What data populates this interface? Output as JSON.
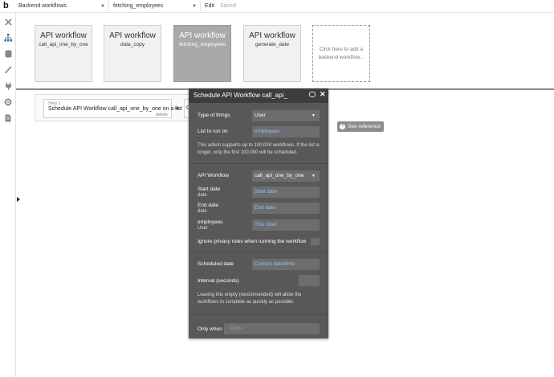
{
  "topbar": {
    "logo": "b",
    "page_select": "Backend workflows",
    "workflow_select": "fetching_employees",
    "edit_label": "Edit",
    "saved_label": "Saved"
  },
  "sidebar": {
    "icons": [
      "tools-icon",
      "hierarchy-icon",
      "database-icon",
      "brush-icon",
      "plug-icon",
      "gear-icon",
      "document-icon"
    ]
  },
  "workflows": [
    {
      "title": "API workflow",
      "name": "call_api_one_by_one"
    },
    {
      "title": "API workflow",
      "name": "data_copy"
    },
    {
      "title": "API workflow",
      "name": "fetching_employees"
    },
    {
      "title": "API workflow",
      "name": "generate_date"
    }
  ],
  "add_workflow": {
    "line1": "Click here to add a",
    "line2": "backend workflow..."
  },
  "step": {
    "number": "Step 1",
    "title": "Schedule API Workflow call_api_one_by_one on a list",
    "delete": "delete",
    "next_initial": "C"
  },
  "see_reference": "See reference",
  "panel": {
    "title": "Schedule API Workflow call_api_",
    "type_of_things": {
      "label": "Type of things",
      "value": "User"
    },
    "list_to_run_on": {
      "label": "List to run on",
      "value": "employees"
    },
    "note1": "This action supports up to 100,000 workflows. If the list is longer, only the first 100,000 will be scheduled.",
    "api_workflow": {
      "label": "API Workflow",
      "value": "call_api_one_by_one"
    },
    "start_date": {
      "label": "Start date",
      "type": "date",
      "value": "Start date"
    },
    "end_date": {
      "label": "End date",
      "type": "date",
      "value": "End date"
    },
    "employees": {
      "label": "employees",
      "type": "User",
      "value": "This User"
    },
    "ignore_privacy": {
      "label": "Ignore privacy rules when running the workflow"
    },
    "scheduled_date": {
      "label": "Scheduled date",
      "value": "Current date/time"
    },
    "interval": {
      "label": "Interval (seconds)"
    },
    "note2": "Leaving this empty (recommended) will allow the workflows to complete as quickly as possible.",
    "only_when": {
      "label": "Only when",
      "placeholder": "Click"
    }
  }
}
